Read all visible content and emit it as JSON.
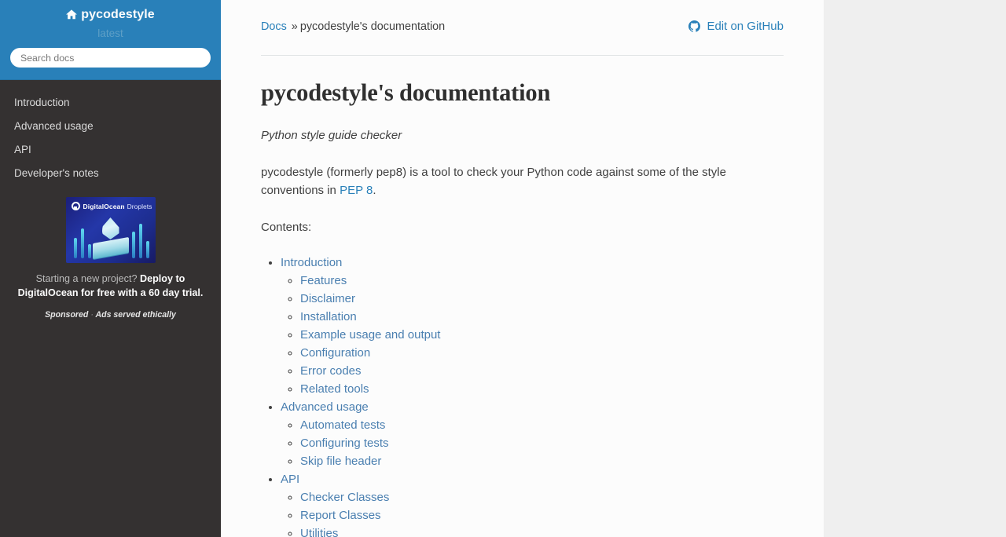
{
  "sidebar": {
    "brand": "pycodestyle",
    "home_icon": "home-icon",
    "version": "latest",
    "search": {
      "placeholder": "Search docs",
      "value": ""
    },
    "nav": [
      {
        "label": "Introduction"
      },
      {
        "label": "Advanced usage"
      },
      {
        "label": "API"
      },
      {
        "label": "Developer's notes"
      }
    ],
    "ad": {
      "banner_brand": "DigitalOcean",
      "banner_product": "Droplets",
      "text_light": "Starting a new project?",
      "text_strong": "Deploy to DigitalOcean for free with a 60 day trial.",
      "sponsored": "Sponsored",
      "separator": "·",
      "ethical": "Ads served ethically"
    }
  },
  "header": {
    "breadcrumb_root": "Docs",
    "breadcrumb_sep": "»",
    "breadcrumb_current": "pycodestyle's documentation",
    "github_label": "Edit on GitHub",
    "github_icon": "github-icon"
  },
  "main": {
    "title": "pycodestyle's documentation",
    "subtitle": "Python style guide checker",
    "intro_prefix": "pycodestyle (formerly pep8) is a tool to check your Python code against some of the style conventions in ",
    "intro_link": "PEP 8",
    "intro_suffix": ".",
    "contents_label": "Contents:",
    "toc": [
      {
        "label": "Introduction",
        "children": [
          {
            "label": "Features"
          },
          {
            "label": "Disclaimer"
          },
          {
            "label": "Installation"
          },
          {
            "label": "Example usage and output"
          },
          {
            "label": "Configuration"
          },
          {
            "label": "Error codes"
          },
          {
            "label": "Related tools"
          }
        ]
      },
      {
        "label": "Advanced usage",
        "children": [
          {
            "label": "Automated tests"
          },
          {
            "label": "Configuring tests"
          },
          {
            "label": "Skip file header"
          }
        ]
      },
      {
        "label": "API",
        "children": [
          {
            "label": "Checker Classes"
          },
          {
            "label": "Report Classes"
          },
          {
            "label": "Utilities"
          }
        ]
      }
    ]
  },
  "colors": {
    "sidebar_header": "#2980b9",
    "sidebar_body": "#343131",
    "link": "#2980b9",
    "toc_link": "#4a7fb0",
    "page_background": "#efefef",
    "content_background": "#fcfcfc",
    "text": "#404040"
  }
}
